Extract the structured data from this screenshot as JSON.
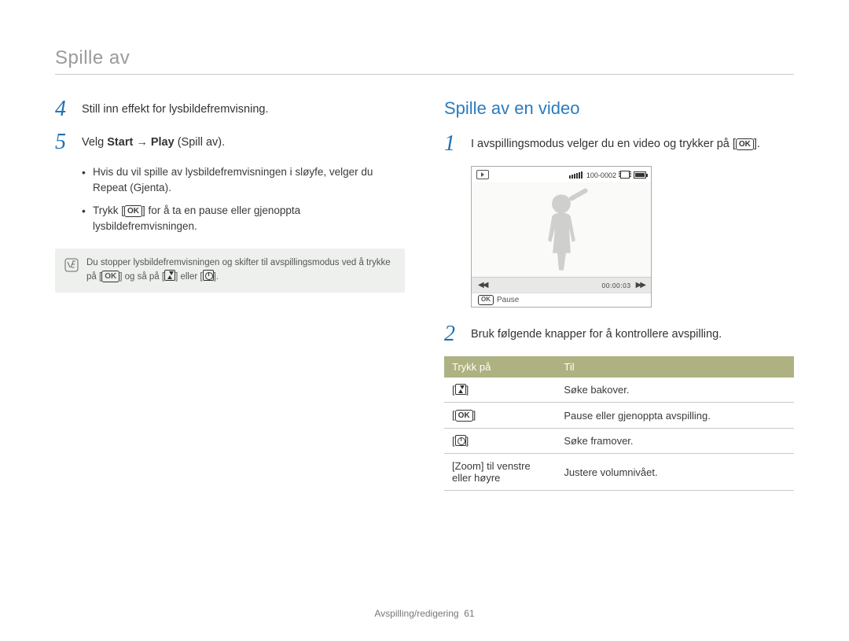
{
  "header": {
    "section": "Spille av"
  },
  "left": {
    "step4": {
      "num": "4",
      "text": "Still inn effekt for lysbildefremvisning."
    },
    "step5": {
      "num": "5",
      "pre": "Velg ",
      "b1": "Start",
      "arrow": " → ",
      "b2": "Play",
      "post": " (Spill av)."
    },
    "bullets": {
      "b1a": "Hvis du vil spille av lysbildefremvisningen i sløyfe, velger du ",
      "b1b": "Repeat",
      "b1c": " (Gjenta).",
      "b2a": "Trykk [",
      "b2b": "] for å ta en pause eller gjenoppta lysbildefremvisningen."
    },
    "note": {
      "a": "Du stopper lysbildefremvisningen og skifter til avspillingsmodus ved å trykke på [",
      "b": "] og så på [",
      "c": "] eller [",
      "d": "]."
    }
  },
  "right": {
    "heading": "Spille av en video",
    "step1": {
      "num": "1",
      "a": "I avspillingsmodus velger du en video og trykker på [",
      "b": "]."
    },
    "preview": {
      "counter": "100-0002",
      "timecode": "00:00:03",
      "ok": "OK",
      "pause": "Pause"
    },
    "step2": {
      "num": "2",
      "text": "Bruk følgende knapper for å kontrollere avspilling."
    },
    "table": {
      "h1": "Trykk på",
      "h2": "Til",
      "r1b": "Søke bakover.",
      "r2b": "Pause eller gjenoppta avspilling.",
      "r3b": "Søke framover.",
      "r4a": "[",
      "r4b": "Zoom",
      "r4c": "] til venstre eller høyre",
      "r4d": "Justere volumnivået."
    }
  },
  "footer": {
    "label": "Avspilling/redigering",
    "page": "61"
  }
}
